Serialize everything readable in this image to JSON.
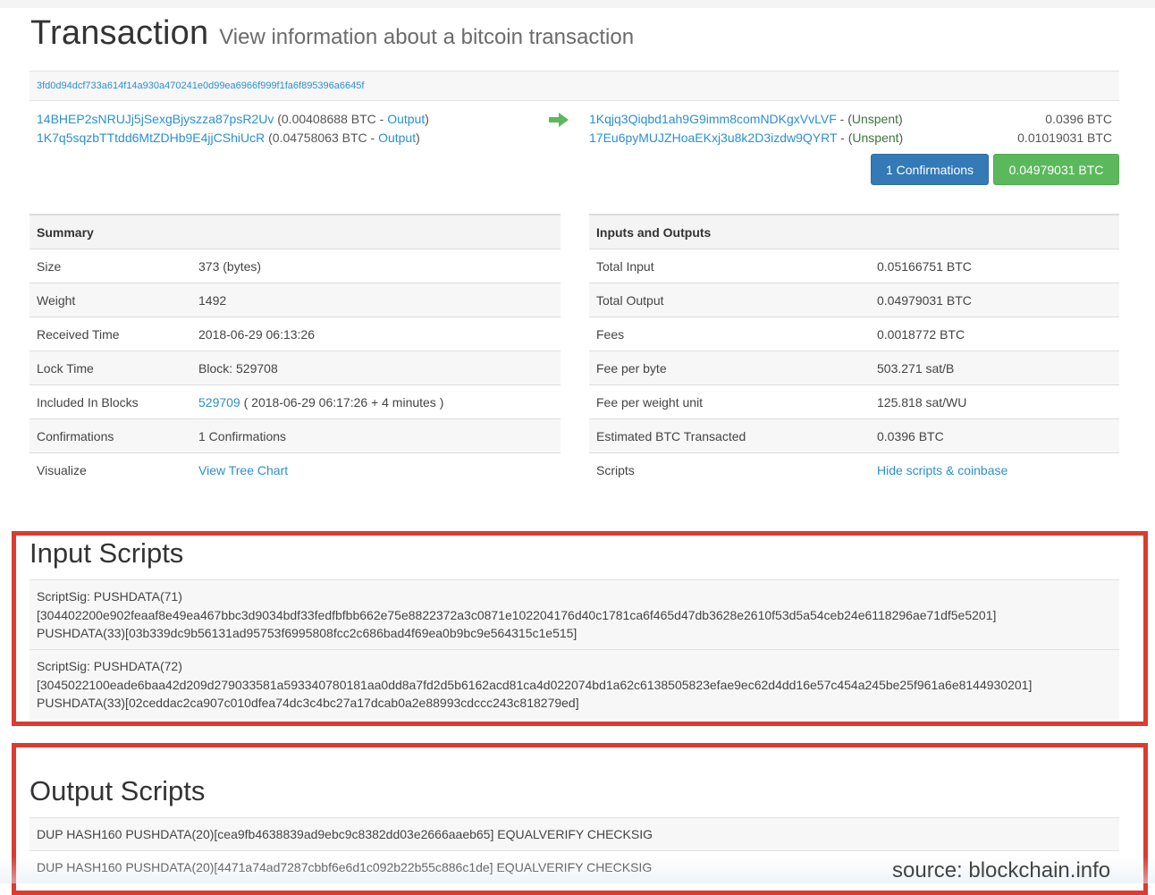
{
  "header": {
    "title": "Transaction",
    "subtitle": "View information about a bitcoin transaction"
  },
  "tx_hash": "3fd0d94dcf733a614f14a930a470241e0d99ea6966f999f1fa6f895396a6645f",
  "inputs": [
    {
      "address": "14BHEP2sNRUJj5jSexgBjyszza87psR2Uv",
      "amount": "(0.00408688 BTC - ",
      "link": "Output",
      "close": ")"
    },
    {
      "address": "1K7q5sqzbTTtdd6MtZDHb9E4jjCShiUcR",
      "amount": "(0.04758063 BTC - ",
      "link": "Output",
      "close": ")"
    }
  ],
  "outputs": [
    {
      "address": "1Kqjq3Qiqbd1ah9G9imm8comNDKgxVvLVF",
      "sep": " - (",
      "status": "Unspent",
      "close": ")",
      "value": "0.0396 BTC"
    },
    {
      "address": "17Eu6pyMUJZHoaEKxj3u8k2D3izdw9QYRT",
      "sep": " - (",
      "status": "Unspent",
      "close": ")",
      "value": "0.01019031 BTC"
    }
  ],
  "buttons": {
    "confirmations": "1 Confirmations",
    "total": "0.04979031 BTC"
  },
  "summary": {
    "heading": "Summary",
    "rows": [
      {
        "label": "Size",
        "value": "373 (bytes)"
      },
      {
        "label": "Weight",
        "value": "1492"
      },
      {
        "label": "Received Time",
        "value": "2018-06-29 06:13:26"
      },
      {
        "label": "Lock Time",
        "value": "Block: 529708"
      },
      {
        "label": "Included In Blocks",
        "link": "529709",
        "value": " ( 2018-06-29 06:17:26 + 4 minutes )"
      },
      {
        "label": "Confirmations",
        "value": "1 Confirmations"
      },
      {
        "label": "Visualize",
        "link": "View Tree Chart"
      }
    ]
  },
  "io_table": {
    "heading": "Inputs and Outputs",
    "rows": [
      {
        "label": "Total Input",
        "value": "0.05166751 BTC"
      },
      {
        "label": "Total Output",
        "value": "0.04979031 BTC"
      },
      {
        "label": "Fees",
        "value": "0.0018772 BTC"
      },
      {
        "label": "Fee per byte",
        "value": "503.271 sat/B"
      },
      {
        "label": "Fee per weight unit",
        "value": "125.818 sat/WU"
      },
      {
        "label": "Estimated BTC Transacted",
        "value": "0.0396 BTC"
      },
      {
        "label": "Scripts",
        "link": "Hide scripts & coinbase"
      }
    ]
  },
  "input_scripts": {
    "title": "Input Scripts",
    "items": [
      {
        "line1": "ScriptSig: PUSHDATA(71)",
        "line2": "[304402200e902feaaf8e49ea467bbc3d9034bdf33fedfbfbb662e75e8822372a3c0871e102204176d40c1781ca6f465d47db3628e2610f53d5a54ceb24e6118296ae71df5e5201]",
        "line3": "PUSHDATA(33)[03b339dc9b56131ad95753f6995808fcc2c686bad4f69ea0b9bc9e564315c1e515]"
      },
      {
        "line1": "ScriptSig: PUSHDATA(72)",
        "line2": "[3045022100eade6baa42d209d279033581a593340780181aa0dd8a7fd2d5b6162acd81ca4d022074bd1a62c6138505823efae9ec62d4dd16e57c454a245be25f961a6e8144930201]",
        "line3": "PUSHDATA(33)[02ceddac2ca907c010dfea74dc3c4bc27a17dcab0a2e88993cdccc243c818279ed]"
      }
    ]
  },
  "output_scripts": {
    "title": "Output Scripts",
    "items": [
      "DUP HASH160 PUSHDATA(20)[cea9fb4638839ad9ebc9c8382dd03e2666aaeb65] EQUALVERIFY CHECKSIG",
      "DUP HASH160 PUSHDATA(20)[4471a74ad7287cbbf6e6d1c092b22b55c886c1de] EQUALVERIFY CHECKSIG"
    ]
  },
  "source_caption": "source: blockchain.info",
  "colors": {
    "link": "#2a8fd6",
    "confirm_button": "#337ab7",
    "total_button": "#5cb85c",
    "arrow": "#5cb85c",
    "highlight_box": "#dd3b30"
  },
  "icons": {
    "transfer_arrow": "arrow-right-icon"
  }
}
